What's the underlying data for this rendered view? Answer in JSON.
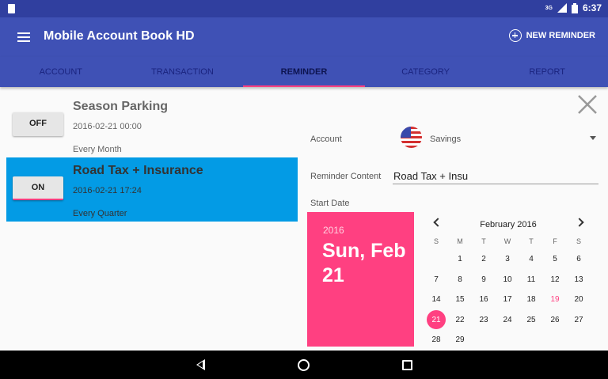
{
  "status_bar": {
    "network": "3G",
    "time": "6:37"
  },
  "app_bar": {
    "title": "Mobile Account Book HD",
    "new_reminder_label": "NEW REMINDER"
  },
  "tabs": [
    {
      "label": "ACCOUNT"
    },
    {
      "label": "TRANSACTION"
    },
    {
      "label": "REMINDER"
    },
    {
      "label": "CATEGORY"
    },
    {
      "label": "REPORT"
    }
  ],
  "active_tab": "REMINDER",
  "reminders": [
    {
      "toggle": "OFF",
      "title": "Season Parking",
      "datetime": "2016-02-21 00:00",
      "frequency": "Every Month"
    },
    {
      "toggle": "ON",
      "title": "Road Tax + Insurance",
      "datetime": "2016-02-21 17:24",
      "frequency": "Every Quarter"
    }
  ],
  "form": {
    "account_label": "Account",
    "account_value": "Savings",
    "content_label": "Reminder Content",
    "content_value": "Road Tax + Insu",
    "start_date_label": "Start Date"
  },
  "date_picker": {
    "year": "2016",
    "date_full": "Sun, Feb 21",
    "month_label": "February 2016",
    "weekdays": [
      "S",
      "M",
      "T",
      "W",
      "T",
      "F",
      "S"
    ],
    "days": [
      "1",
      "2",
      "3",
      "4",
      "5",
      "6",
      "7",
      "8",
      "9",
      "10",
      "11",
      "12",
      "13",
      "14",
      "15",
      "16",
      "17",
      "18",
      "19",
      "20",
      "21",
      "22",
      "23",
      "24",
      "25",
      "26",
      "27",
      "28",
      "29"
    ],
    "first_weekday_offset": 1,
    "today": "19",
    "selected": "21"
  },
  "colors": {
    "primary": "#3f51b5",
    "primary_dark": "#303f9f",
    "accent": "#ff4081",
    "selected_row": "#039be5"
  },
  "icons": {
    "menu": "menu-icon",
    "add": "plus-circle-icon",
    "close": "close-icon",
    "flag": "us-flag-icon"
  }
}
